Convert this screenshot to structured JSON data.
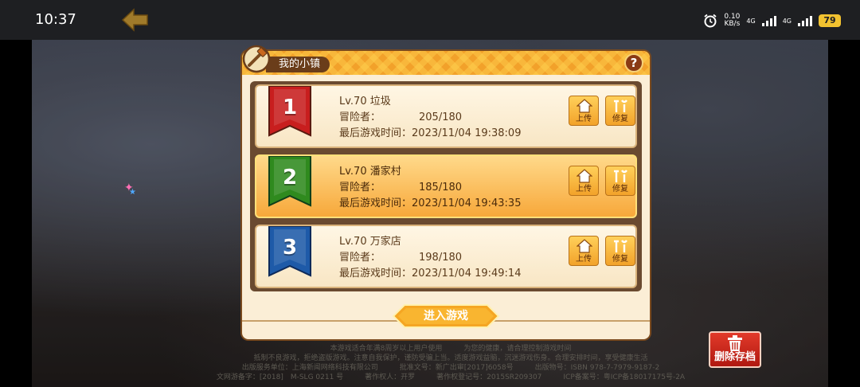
{
  "status_bar": {
    "time": "10:37",
    "net_speed_value": "0.10",
    "net_speed_unit": "KB/s",
    "sig1": "4G",
    "sig2": "4G",
    "battery": "79"
  },
  "panel": {
    "title": "我的小镇",
    "help": "?",
    "enter_button": "进入游戏"
  },
  "slots": [
    {
      "number": "1",
      "ribbon_color": "#c81e1e",
      "level": "Lv.70",
      "name": "垃圾",
      "adventurer_label": "冒险者",
      "adventurers": "205/180",
      "last_played_label": "最后游戏时间",
      "last_played": "2023/11/04 19:38:09",
      "upload": "上传",
      "repair": "修复",
      "active": false
    },
    {
      "number": "2",
      "ribbon_color": "#2f8a1e",
      "level": "Lv.70",
      "name": "潘家村",
      "adventurer_label": "冒险者",
      "adventurers": "185/180",
      "last_played_label": "最后游戏时间",
      "last_played": "2023/11/04 19:43:35",
      "upload": "上传",
      "repair": "修复",
      "active": true
    },
    {
      "number": "3",
      "ribbon_color": "#1e5aa8",
      "level": "Lv.70",
      "name": "万家店",
      "adventurer_label": "冒险者",
      "adventurers": "198/180",
      "last_played_label": "最后游戏时间",
      "last_played": "2023/11/04 19:49:14",
      "upload": "上传",
      "repair": "修复",
      "active": false
    }
  ],
  "delete_button": "删除存档",
  "footer_lines": [
    "本游戏适合年满8周岁以上用户使用　　　为您的健康，请合理控制游戏时间",
    "抵制不良游戏，拒绝盗版游戏。注意自我保护，谨防受骗上当。适度游戏益脑，沉迷游戏伤身。合理安排时间，享受健康生活",
    "出版服务单位：上海新闻网络科技有限公司　　　批准文号：新广出审[2017]6058号　　　出版物号：ISBN 978-7-7979-9187-2",
    "文网游备字：[2018]　M-SLG 0211 号　　　著作权人：开罗　　　著作权登记号：2015SR209307　　　ICP备案号：粤ICP备18017175号-2A"
  ]
}
